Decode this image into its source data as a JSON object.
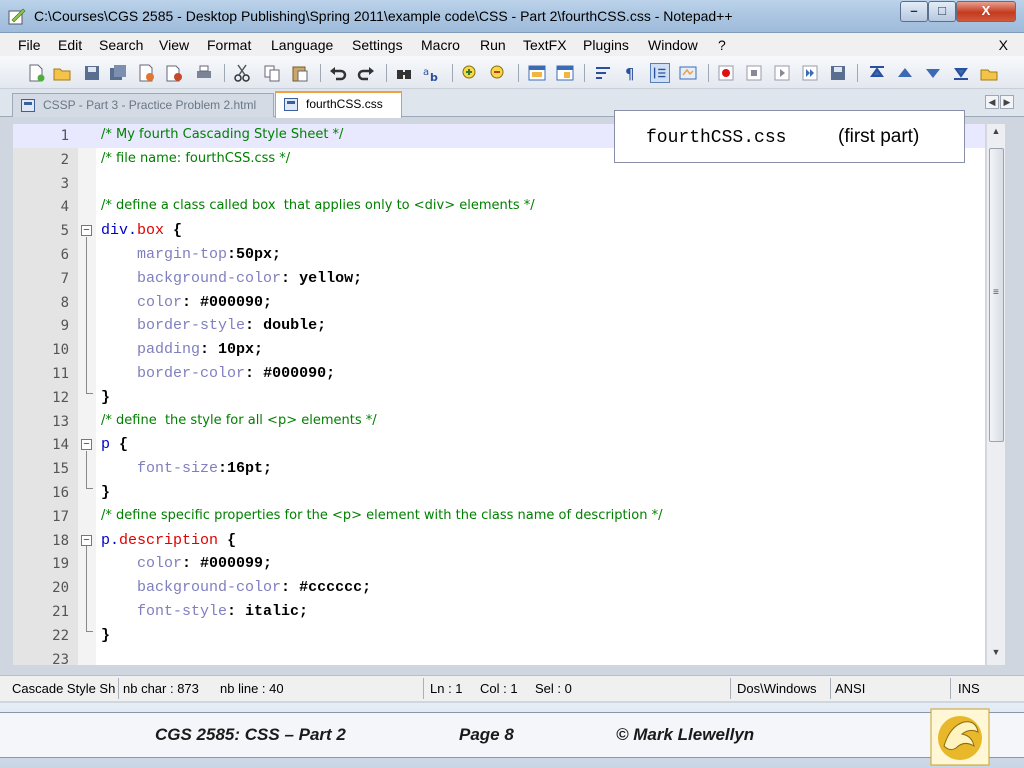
{
  "window": {
    "title": "C:\\Courses\\CGS 2585 - Desktop Publishing\\Spring 2011\\example code\\CSS - Part 2\\fourthCSS.css - Notepad++",
    "min_label": "–",
    "max_label": "□",
    "close_label": "X"
  },
  "menu": {
    "items": [
      "File",
      "Edit",
      "Search",
      "View",
      "Format",
      "Language",
      "Settings",
      "Macro",
      "Run",
      "TextFX",
      "Plugins",
      "Window",
      "?"
    ],
    "close_label": "X"
  },
  "toolbar": {
    "icons": [
      "new-file-icon",
      "open-file-icon",
      "save-icon",
      "save-all-icon",
      "close-file-icon",
      "close-all-icon",
      "print-icon",
      "cut-icon",
      "copy-icon",
      "paste-icon",
      "undo-icon",
      "redo-icon",
      "find-icon",
      "replace-icon",
      "zoom-in-icon",
      "zoom-out-icon",
      "sync-vertical-icon",
      "sync-horizontal-icon",
      "word-wrap-icon",
      "show-all-chars-icon",
      "indent-guide-icon",
      "user-lang-icon",
      "record-macro-icon",
      "stop-record-icon",
      "playback-macro-icon",
      "run-macro-multiple-icon",
      "save-macro-icon",
      "trim-icon",
      "move-up-icon",
      "move-down-icon",
      "sort-icon",
      "tidy-icon"
    ]
  },
  "tabs": [
    {
      "label": "CSSP - Part 3 - Practice Problem 2.html",
      "active": false
    },
    {
      "label": "fourthCSS.css",
      "active": true
    }
  ],
  "callout": {
    "filename": "fourthCSS.css",
    "note": "(first part)"
  },
  "code_lines": [
    {
      "n": "1",
      "t": "/* My fourth Cascading Style Sheet */"
    },
    {
      "n": "2",
      "t": "/* file name: fourthCSS.css */"
    },
    {
      "n": "3",
      "t": ""
    },
    {
      "n": "4",
      "t": "/* define a class called box  that applies only to <div> elements */"
    },
    {
      "n": "5",
      "t": "div.box {"
    },
    {
      "n": "6",
      "t": "    margin-top:50px;"
    },
    {
      "n": "7",
      "t": "    background-color: yellow;"
    },
    {
      "n": "8",
      "t": "    color: #000090;"
    },
    {
      "n": "9",
      "t": "    border-style: double;"
    },
    {
      "n": "10",
      "t": "    padding: 10px;"
    },
    {
      "n": "11",
      "t": "    border-color: #000090;"
    },
    {
      "n": "12",
      "t": "}"
    },
    {
      "n": "13",
      "t": "/* define  the style for all <p> elements */"
    },
    {
      "n": "14",
      "t": "p {"
    },
    {
      "n": "15",
      "t": "    font-size:16pt;"
    },
    {
      "n": "16",
      "t": "}"
    },
    {
      "n": "17",
      "t": "/* define specific properties for the <p> element with the class name of description */"
    },
    {
      "n": "18",
      "t": "p.description {"
    },
    {
      "n": "19",
      "t": "    color: #000099;"
    },
    {
      "n": "20",
      "t": "    background-color: #cccccc;"
    },
    {
      "n": "21",
      "t": "    font-style: italic;"
    },
    {
      "n": "22",
      "t": "}"
    },
    {
      "n": "23",
      "t": ""
    }
  ],
  "status": {
    "lang": "Cascade Style Sh",
    "chars": "nb char : 873",
    "lines": "nb line : 40",
    "ln": "Ln : 1",
    "col": "Col : 1",
    "sel": "Sel : 0",
    "eol": "Dos\\Windows",
    "encoding": "ANSI",
    "mode": "INS"
  },
  "footer": {
    "course": "CGS 2585: CSS – Part 2",
    "page": "Page 8",
    "author": "© Mark Llewellyn"
  },
  "colors": {
    "comment": "#008000",
    "selector": "#0000c8",
    "class": "#e00000",
    "property": "#7f7fbf",
    "current_line": "#e8e8ff"
  }
}
